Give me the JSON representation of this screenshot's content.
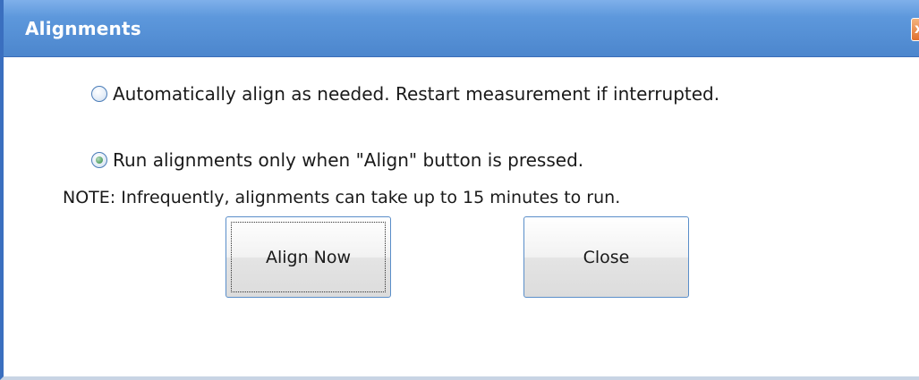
{
  "window": {
    "title": "Alignments",
    "close_glyph": "x"
  },
  "options": [
    {
      "label": "Automatically align as needed. Restart measurement if interrupted.",
      "selected": false
    },
    {
      "label": "Run alignments only when \"Align\" button is pressed.",
      "selected": true
    }
  ],
  "note": "NOTE: Infrequently, alignments can take up to 15 minutes to run.",
  "buttons": {
    "align_now": "Align Now",
    "close": "Close"
  },
  "colors": {
    "titlebar": "#5d98dc",
    "close_box": "#e0702f",
    "radio_selected_dot": "#5fa86e",
    "button_border": "#5a8ec9"
  }
}
